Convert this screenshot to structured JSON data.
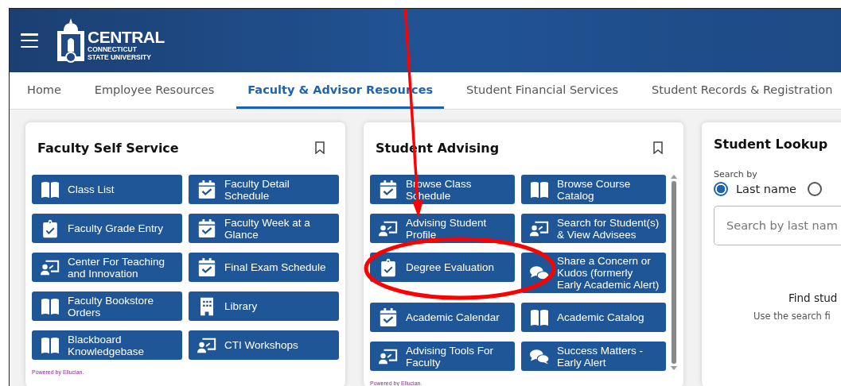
{
  "header": {
    "logo": {
      "name": "CENTRAL",
      "line_1": "CONNECTICUT",
      "line_2": "STATE UNIVERSITY"
    }
  },
  "tabs": [
    {
      "label": "Home",
      "selected": false
    },
    {
      "label": "Employee Resources",
      "selected": false
    },
    {
      "label": "Faculty & Advisor Resources",
      "selected": true
    },
    {
      "label": "Student Financial Services",
      "selected": false
    },
    {
      "label": "Student Records & Registration",
      "selected": false
    }
  ],
  "cards": [
    {
      "title": "Faculty Self Service",
      "footer": "Powered by Ellucian.",
      "scrollable": false,
      "links": [
        {
          "label": "Class List",
          "kind": "book"
        },
        {
          "label": "Faculty Detail Schedule",
          "kind": "calendar"
        },
        {
          "label": "Faculty Grade Entry",
          "kind": "clipboard"
        },
        {
          "label": "Faculty Week at a Glance",
          "kind": "calendar"
        },
        {
          "label": "Center For Teaching and Innovation",
          "kind": "presenter"
        },
        {
          "label": "Final Exam Schedule",
          "kind": "calendar"
        },
        {
          "label": "Faculty Bookstore Orders",
          "kind": "book"
        },
        {
          "label": "Library",
          "kind": "building"
        },
        {
          "label": "Blackboard Knowledgebase",
          "kind": "book"
        },
        {
          "label": "CTI Workshops",
          "kind": "presenter"
        }
      ]
    },
    {
      "title": "Student Advising",
      "footer": "Powered by Ellucian.",
      "scrollable": true,
      "links": [
        {
          "label": "Browse Class Schedule",
          "kind": "calendar"
        },
        {
          "label": "Browse Course Catalog",
          "kind": "book"
        },
        {
          "label": "Advising Student Profile",
          "kind": "presenter"
        },
        {
          "label": "Search for Student(s) & View Advisees",
          "kind": "presenter"
        },
        {
          "label": "Degree Evaluation",
          "kind": "clipboard"
        },
        {
          "label": "Share a Concern or Kudos (formerly Early Academic Alert)",
          "kind": "chat"
        },
        {
          "label": "Academic Calendar",
          "kind": "calendar"
        },
        {
          "label": "Academic Catalog",
          "kind": "book"
        },
        {
          "label": "Advising Tools For Faculty",
          "kind": "presenter"
        },
        {
          "label": "Success Matters - Early Alert",
          "kind": "chat"
        }
      ]
    }
  ],
  "lookup": {
    "title": "Student Lookup",
    "search_by": "Search by",
    "options": [
      {
        "label": "Last name",
        "selected": true
      },
      {
        "selected": false
      }
    ],
    "placeholder": "Search by last nam",
    "empty_title": "Find stud",
    "empty_text": "Use the search fi"
  }
}
